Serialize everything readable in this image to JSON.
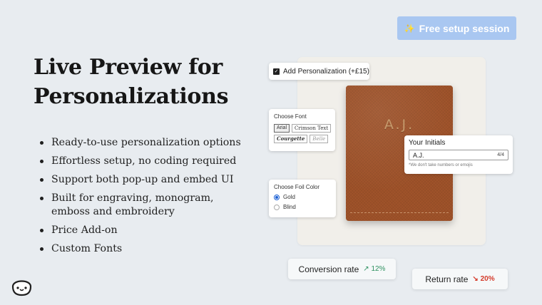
{
  "cta": {
    "icon": "sparkle-icon",
    "label": "Free setup session"
  },
  "headline": [
    "Live Preview for",
    "Personalizations"
  ],
  "bullets": [
    "Ready-to-use personalization options",
    "Effortless setup, no coding required",
    "Support both pop-up and embed UI",
    "Built for engraving, monogram, emboss and embroidery",
    "Price Add-on",
    "Custom Fonts"
  ],
  "preview": {
    "product_initials": "A.J.",
    "add_personalization": {
      "label": "Add Personalization (+£15)",
      "checked": true
    },
    "font_picker": {
      "title": "Choose Font",
      "options": [
        "Arial",
        "Crimson Text",
        "Courgette",
        "Belle"
      ],
      "selected": "Arial"
    },
    "initials_field": {
      "title": "Your Initials",
      "value": "A.J.",
      "counter": "4/4",
      "note": "*We don't take numbers or emojis"
    },
    "foil_picker": {
      "title": "Choose Foil Color",
      "options": [
        "Gold",
        "Blind"
      ],
      "selected": "Gold"
    }
  },
  "stats": {
    "conversion": {
      "label": "Conversion rate",
      "arrow": "↗",
      "value": "12%"
    },
    "return": {
      "label": "Return rate",
      "arrow": "↘",
      "value": "20%"
    }
  },
  "colors": {
    "background": "#e8ecf0",
    "cta": "#a9c7f1",
    "leather": "#a0532a",
    "positive": "#2e9160",
    "negative": "#d43a2a",
    "radio_selected": "#1a5fd4"
  },
  "logo": {
    "icon": "smiley-face-icon"
  }
}
